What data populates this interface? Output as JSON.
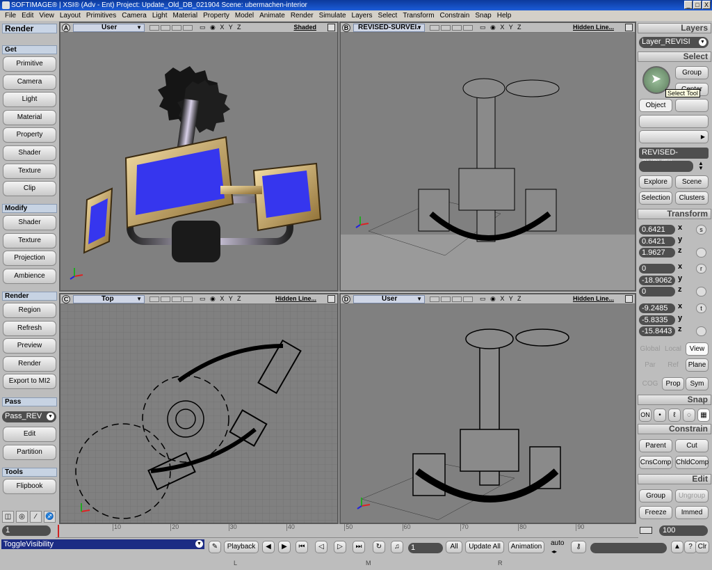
{
  "window": {
    "title": "SOFTIMAGE® | XSI® (Adv - Ent) Project: Update_Old_DB_021904   Scene: ubermachen-interior",
    "buttons": [
      "_",
      "□",
      "X"
    ]
  },
  "menu": [
    "File",
    "Edit",
    "View",
    "Layout",
    "Primitives",
    "Camera",
    "Light",
    "Material",
    "Property",
    "Model",
    "Animate",
    "Render",
    "Simulate",
    "Layers",
    "Select",
    "Transform",
    "Constrain",
    "Snap",
    "Help"
  ],
  "left_panel": {
    "title": "Render",
    "sections": {
      "get": "Get",
      "modify": "Modify",
      "render": "Render",
      "pass": "Pass",
      "tools": "Tools"
    },
    "get_buttons": [
      "Primitive",
      "Camera",
      "Light",
      "Material",
      "Property",
      "Shader",
      "Texture",
      "Clip"
    ],
    "modify_buttons": [
      "Shader",
      "Texture",
      "Projection",
      "Ambience"
    ],
    "render_buttons": [
      "Region",
      "Refresh",
      "Preview",
      "Render",
      "Export to MI2"
    ],
    "pass_value": "Pass_REV",
    "pass_buttons": [
      "Edit",
      "Partition"
    ],
    "tools_buttons": [
      "Flipbook"
    ]
  },
  "viewports": {
    "a": {
      "letter": "A",
      "camera": "User",
      "mode": "Shaded",
      "axes": "X Y Z"
    },
    "b": {
      "letter": "B",
      "camera": "REVISED-SURVEI..",
      "mode": "Hidden Line...",
      "axes": "X Y Z"
    },
    "c": {
      "letter": "C",
      "camera": "Top",
      "mode": "Hidden Line...",
      "axes": "X Y Z"
    },
    "d": {
      "letter": "D",
      "camera": "User",
      "mode": "Hidden Line...",
      "axes": "X Y Z"
    }
  },
  "right_panel": {
    "layers_title": "Layers",
    "layer_value": "Layer_REVISI",
    "select_title": "Select",
    "group_btn": "Group",
    "center_btn": "Center",
    "tooltip": "Select Tool",
    "object_btn": "Object",
    "object_name": "REVISED-SURVEIL",
    "explore_btn": "Explore",
    "scene_btn": "Scene",
    "selection_btn": "Selection",
    "clusters_btn": "Clusters",
    "transform_title": "Transform",
    "scale": [
      "0.6421",
      "0.6421",
      "1.9627"
    ],
    "rotation": [
      "0",
      "-18.9062",
      "0"
    ],
    "translation": [
      "-9.2485",
      "-5.8335",
      "-15.8443"
    ],
    "axes": [
      "x",
      "y",
      "z"
    ],
    "side_labels": [
      "s",
      "r",
      "t"
    ],
    "global_btn": "Global",
    "local_btn": "Local",
    "view_btn": "View",
    "par_btn": "Par",
    "ref_btn": "Ref",
    "plane_btn": "Plane",
    "cog_btn": "COG",
    "prop_btn": "Prop",
    "sym_btn": "Sym",
    "snap_title": "Snap",
    "snap_on": "ON",
    "constrain_title": "Constrain",
    "parent_btn": "Parent",
    "cut_btn": "Cut",
    "cnscomp_btn": "CnsComp",
    "chldcomp_btn": "ChldComp",
    "edit_title": "Edit",
    "group2_btn": "Group",
    "ungroup_btn": "Ungroup",
    "freeze_btn": "Freeze",
    "immed_btn": "Immed"
  },
  "timeline": {
    "start": "1",
    "end": "100",
    "ticks": [
      "10",
      "20",
      "30",
      "40",
      "50",
      "60",
      "70",
      "80",
      "90"
    ]
  },
  "bottom": {
    "script": "ToggleVisibility",
    "playback": "Playback",
    "frame": "1",
    "all": "All",
    "update_all": "Update All",
    "animation": "Animation",
    "auto": "auto",
    "clr": "Clr",
    "mouse": [
      "L",
      "M",
      "R"
    ]
  }
}
